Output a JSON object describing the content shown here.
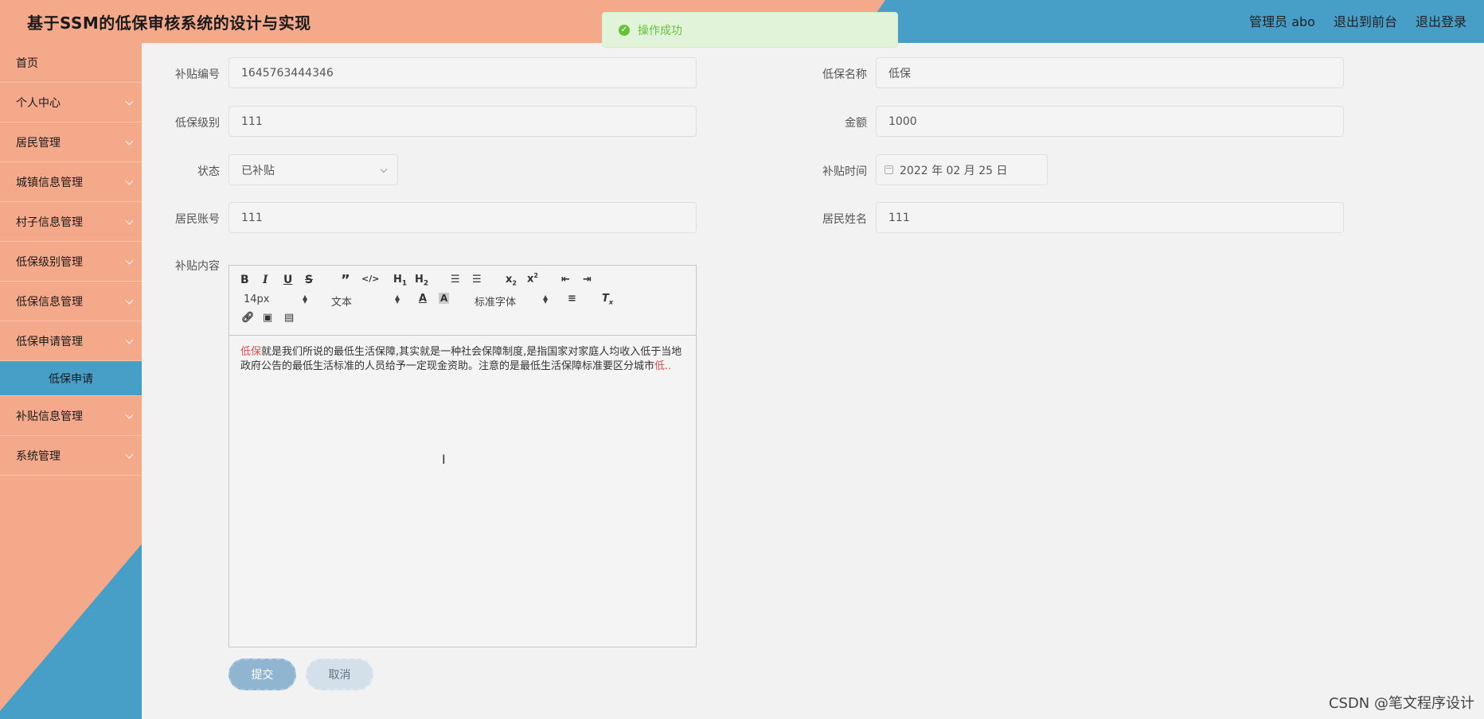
{
  "header": {
    "title": "基于SSM的低保审核系统的设计与实现",
    "user": "管理员 abo",
    "to_front": "退出到前台",
    "logout": "退出登录"
  },
  "toast": {
    "message": "操作成功",
    "icon": "success-check-icon",
    "color": "#67c23a"
  },
  "sidebar": {
    "items": [
      {
        "label": "首页"
      },
      {
        "label": "个人中心"
      },
      {
        "label": "居民管理"
      },
      {
        "label": "城镇信息管理"
      },
      {
        "label": "村子信息管理"
      },
      {
        "label": "低保级别管理"
      },
      {
        "label": "低保信息管理"
      },
      {
        "label": "低保申请管理"
      },
      {
        "label": "补贴信息管理"
      },
      {
        "label": "系统管理"
      }
    ],
    "sub_item": "低保申请"
  },
  "form": {
    "subsidy_no": {
      "label": "补贴编号",
      "value": "1645763444346"
    },
    "dibao_name": {
      "label": "低保名称",
      "value": "低保"
    },
    "dibao_level": {
      "label": "低保级别",
      "value": "111"
    },
    "amount": {
      "label": "金额",
      "value": "1000"
    },
    "status": {
      "label": "状态",
      "value": "已补贴"
    },
    "subsidy_time": {
      "label": "补贴时间",
      "value": "2022 年 02 月 25 日"
    },
    "resident_account": {
      "label": "居民账号",
      "value": "111"
    },
    "resident_name": {
      "label": "居民姓名",
      "value": "111"
    },
    "content": {
      "label": "补贴内容"
    }
  },
  "editor": {
    "font_size": "14px",
    "format": "文本",
    "font_family": "标准字体",
    "text_red_start": "低保",
    "text_main": "就是我们所说的最低生活保障,其实就是一种社会保障制度,是指国家对家庭人均收入低于当地政府公告的最低生活标准的人员给予一定现金资助。注意的是最低生活保障标准要区分城市",
    "text_red_end": "低.."
  },
  "buttons": {
    "submit": "提交",
    "cancel": "取消"
  },
  "watermark": "CSDN @笔文程序设计",
  "colors": {
    "peach": "#f5a98b",
    "blue": "#479ec6"
  }
}
